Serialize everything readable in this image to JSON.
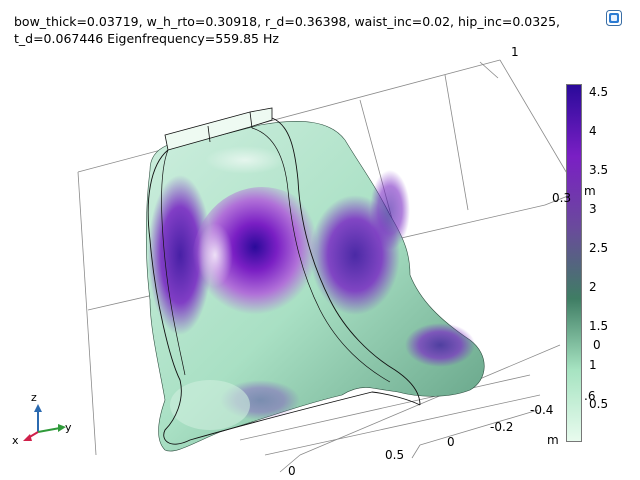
{
  "plot": {
    "title_line1": "bow_thick=0.03719, w_h_rto=0.30918, r_d=0.36398, waist_inc=0.02, hip_inc=0.0325,",
    "title_line2": "t_d=0.067446 Eigenfrequency=559.85 Hz"
  },
  "colorbar": {
    "colors": [
      "#e8fbee",
      "#a6e3c1",
      "#3f7d64",
      "#6a4a9c",
      "#7a1fc4",
      "#2a0a9a"
    ],
    "ticks": [
      "4.5",
      "4",
      "3.5",
      "3",
      "2.5",
      "2",
      "1.5",
      "1",
      "0.5"
    ],
    "unit": "m"
  },
  "axis_labels": {
    "top_1": "1",
    "right_03": "0.3",
    "right_m": "m",
    "cb_0": "0",
    "cb_6": ".6",
    "x_neg04": "-0.4",
    "x_neg02": "-0.2",
    "x_0a": "0",
    "x_05": "0.5",
    "x_0b": "0",
    "x_m": "m"
  },
  "triad": {
    "z": "z",
    "y": "y",
    "x": "x"
  }
}
